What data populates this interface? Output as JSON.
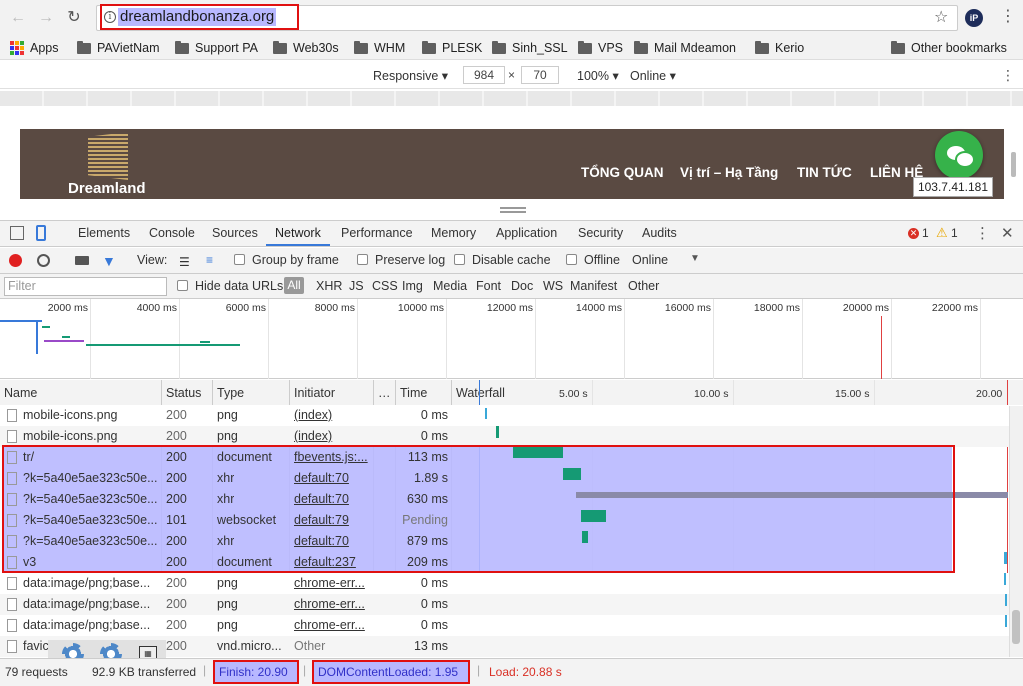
{
  "browser": {
    "url": "dreamlandbonanza.org",
    "bookmarks": [
      "Apps",
      "PAVietNam",
      "Support PA",
      "Web30s",
      "WHM",
      "PLESK",
      "Sinh_SSL",
      "VPS",
      "Mail Mdeamon",
      "Kerio"
    ],
    "other_bookmarks": "Other bookmarks",
    "ext_label": "iP"
  },
  "device_toolbar": {
    "mode": "Responsive",
    "width": "984",
    "height": "70",
    "times": "×",
    "zoom": "100%",
    "network": "Online"
  },
  "site": {
    "logo_text": "Dreamland",
    "nav": [
      "TỔNG QUAN",
      "Vị trí – Hạ Tầng",
      "TIN TỨC",
      "LIÊN HỆ"
    ],
    "ip_tooltip": "103.7.41.181"
  },
  "devtools": {
    "tabs": [
      "Elements",
      "Console",
      "Sources",
      "Network",
      "Performance",
      "Memory",
      "Application",
      "Security",
      "Audits"
    ],
    "active_tab": "Network",
    "errors": "1",
    "warnings": "1",
    "toolbar": {
      "view_label": "View:",
      "group_by_frame": "Group by frame",
      "preserve_log": "Preserve log",
      "disable_cache": "Disable cache",
      "offline": "Offline",
      "throttle": "Online"
    },
    "filter": {
      "placeholder": "Filter",
      "hide_data_urls": "Hide data URLs",
      "all": "All",
      "types": [
        "XHR",
        "JS",
        "CSS",
        "Img",
        "Media",
        "Font",
        "Doc",
        "WS",
        "Manifest",
        "Other"
      ]
    },
    "overview_ticks": [
      "2000 ms",
      "4000 ms",
      "6000 ms",
      "8000 ms",
      "10000 ms",
      "12000 ms",
      "14000 ms",
      "16000 ms",
      "18000 ms",
      "20000 ms",
      "22000 ms"
    ],
    "columns": {
      "name": "Name",
      "status": "Status",
      "type": "Type",
      "initiator": "Initiator",
      "more": "…",
      "time": "Time",
      "waterfall": "Waterfall"
    },
    "waterfall_ticks": [
      "5.00 s",
      "10.00 s",
      "15.00 s",
      "20.00"
    ],
    "rows": [
      {
        "name": "mobile-icons.png",
        "status": "200",
        "type": "png",
        "initiator": "(index)",
        "time": "0 ms"
      },
      {
        "name": "mobile-icons.png",
        "status": "200",
        "type": "png",
        "initiator": "(index)",
        "time": "0 ms"
      },
      {
        "name": "tr/",
        "status": "200",
        "type": "document",
        "initiator": "fbevents.js:...",
        "time": "113 ms"
      },
      {
        "name": "?k=5a40e5ae323c50e...",
        "status": "200",
        "type": "xhr",
        "initiator": "default:70",
        "time": "1.89 s"
      },
      {
        "name": "?k=5a40e5ae323c50e...",
        "status": "200",
        "type": "xhr",
        "initiator": "default:70",
        "time": "630 ms"
      },
      {
        "name": "?k=5a40e5ae323c50e...",
        "status": "101",
        "type": "websocket",
        "initiator": "default:79",
        "time": "Pending"
      },
      {
        "name": "?k=5a40e5ae323c50e...",
        "status": "200",
        "type": "xhr",
        "initiator": "default:70",
        "time": "879 ms"
      },
      {
        "name": "v3",
        "status": "200",
        "type": "document",
        "initiator": "default:237",
        "time": "209 ms"
      },
      {
        "name": "data:image/png;base...",
        "status": "200",
        "type": "png",
        "initiator": "chrome-err...",
        "time": "0 ms"
      },
      {
        "name": "data:image/png;base...",
        "status": "200",
        "type": "png",
        "initiator": "chrome-err...",
        "time": "0 ms"
      },
      {
        "name": "data:image/png;base...",
        "status": "200",
        "type": "png",
        "initiator": "chrome-err...",
        "time": "0 ms"
      },
      {
        "name": "favic",
        "status": "200",
        "type": "vnd.micro...",
        "initiator": "Other",
        "time": "13 ms"
      }
    ],
    "status_bar": {
      "requests": "79 requests",
      "transferred": "92.9 KB transferred",
      "finish": "Finish: 20.90 s",
      "dcl": "DOMContentLoaded: 1.95 s",
      "load": "Load: 20.88 s"
    }
  }
}
